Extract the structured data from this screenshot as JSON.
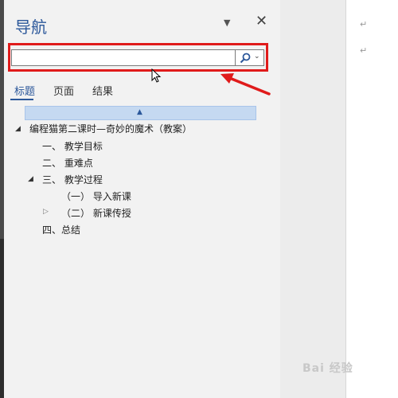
{
  "nav": {
    "title": "导航",
    "search": {
      "value": "",
      "placeholder": ""
    },
    "tabs": [
      "标题",
      "页面",
      "结果"
    ],
    "active_tab": "标题",
    "headings": [
      {
        "label": "编程猫第二课时—奇妙的魔术（教案）",
        "expander": "open"
      },
      {
        "label": "一、 教学目标"
      },
      {
        "label": "二、 重难点"
      },
      {
        "label": "三、 教学过程",
        "expander": "open"
      },
      {
        "label": "（一） 导入新课"
      },
      {
        "label": "（二） 新课传授",
        "expander": "closed"
      },
      {
        "label": "四、总结"
      }
    ]
  },
  "document": {
    "paragraph_marks": [
      "↵",
      "↵"
    ]
  },
  "watermark": "Bai 经验",
  "colors": {
    "accent": "#2b579a",
    "highlight": "#e01b1b",
    "collapse_bar": "#c5d9f1"
  }
}
